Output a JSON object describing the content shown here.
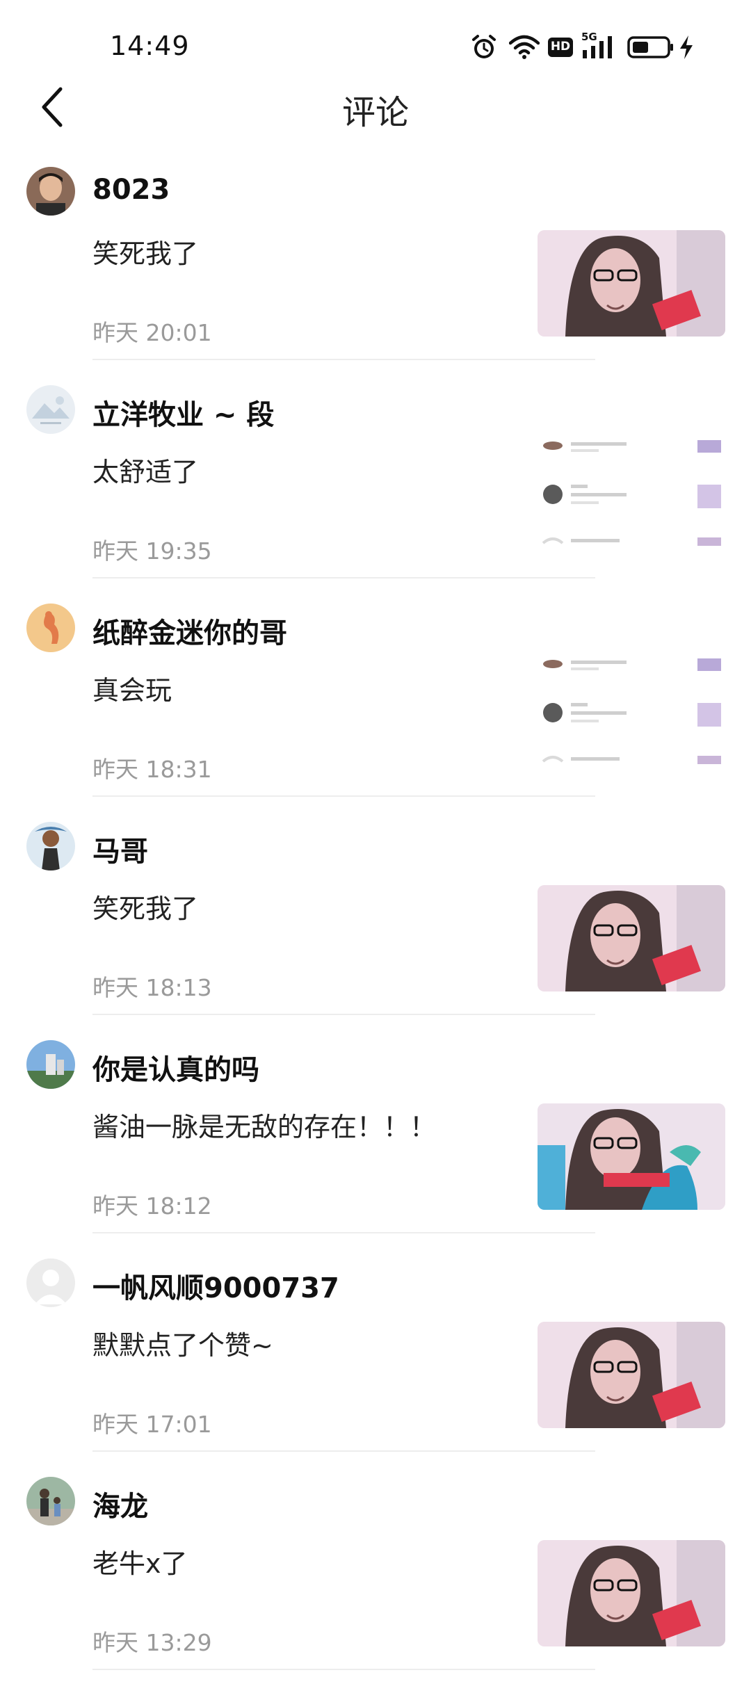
{
  "status_bar": {
    "time": "14:49",
    "hd_label": "HD",
    "network_label": "5G",
    "icons": [
      "alarm-icon",
      "wifi-icon",
      "hd-icon",
      "signal-icon",
      "battery-icon",
      "charging-icon"
    ]
  },
  "header": {
    "title": "评论",
    "back_icon": "chevron-left-icon"
  },
  "comments": [
    {
      "username": "8023",
      "text": "笑死我了",
      "time": "昨天 20:01",
      "thumb": "video-frame"
    },
    {
      "username": "立洋牧业 ~ 段",
      "text": "太舒适了",
      "time": "昨天 19:35",
      "thumb": "notification-list"
    },
    {
      "username": "纸醉金迷你的哥",
      "text": "真会玩",
      "time": "昨天 18:31",
      "thumb": "notification-list"
    },
    {
      "username": "马哥",
      "text": "笑死我了",
      "time": "昨天 18:13",
      "thumb": "video-frame"
    },
    {
      "username": "你是认真的吗",
      "text": "酱油一脉是无敌的存在！！！",
      "time": "昨天 18:12",
      "thumb": "video-frame"
    },
    {
      "username": "一帆风顺9000737",
      "text": "默默点了个赞~",
      "time": "昨天 17:01",
      "thumb": "video-frame"
    },
    {
      "username": "海龙",
      "text": "老牛x了",
      "time": "昨天 13:29",
      "thumb": "video-frame"
    }
  ]
}
